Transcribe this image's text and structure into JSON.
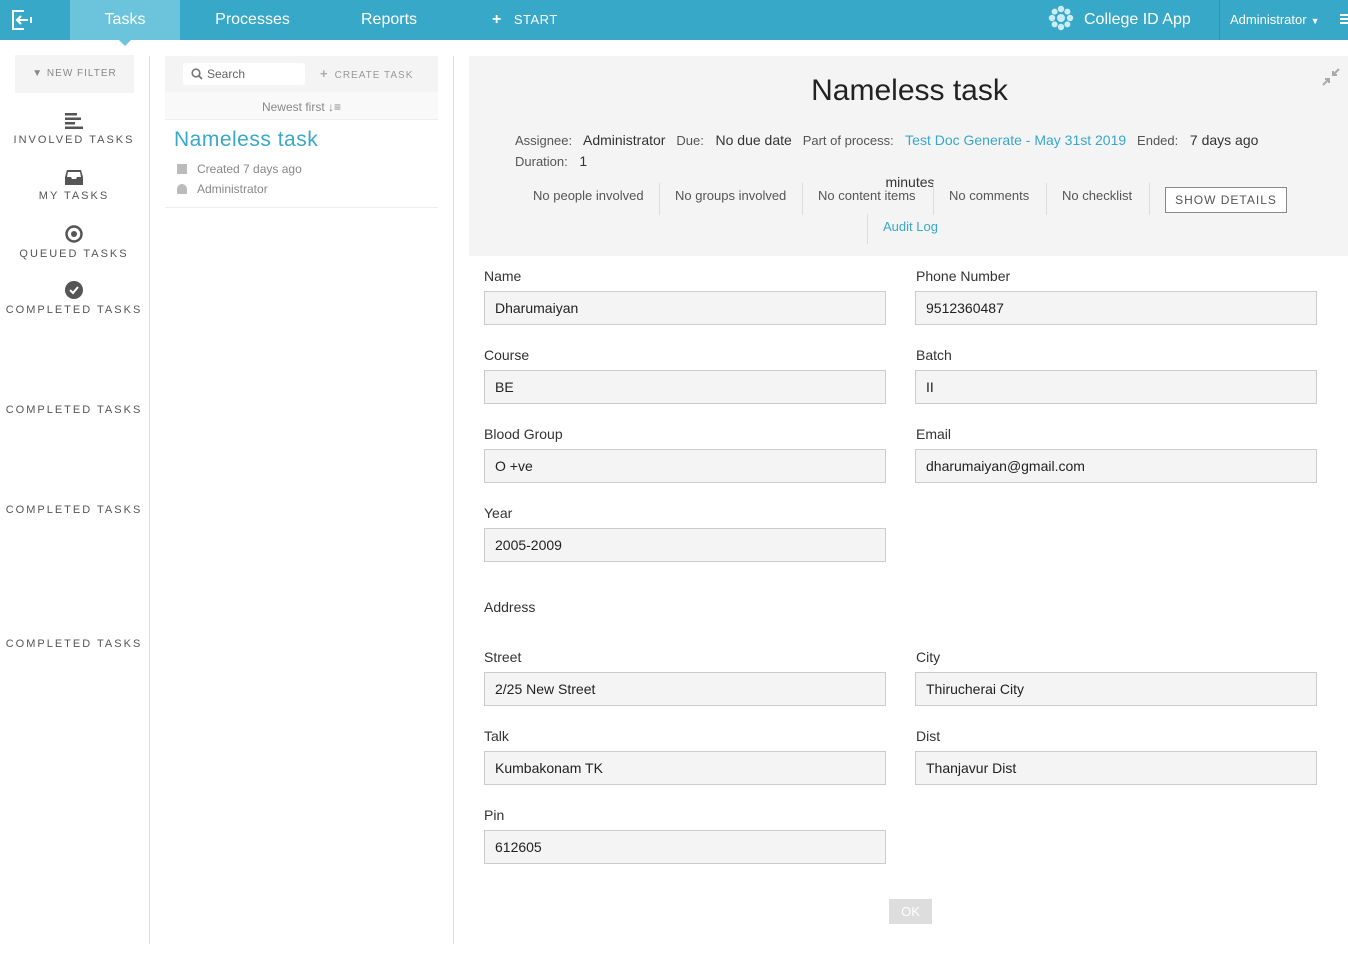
{
  "nav": {
    "tabs": [
      {
        "label": "Tasks",
        "active": true
      },
      {
        "label": "Processes",
        "active": false
      },
      {
        "label": "Reports",
        "active": false
      }
    ],
    "start_label": "START",
    "app_title": "College ID App",
    "user_label": "Administrator",
    "accent_color": "#38a8c9"
  },
  "sidebar": {
    "new_filter_label": "NEW FILTER",
    "items": [
      {
        "label": "INVOLVED TASKS",
        "icon": "involved-tasks-icon"
      },
      {
        "label": "MY TASKS",
        "icon": "inbox-icon"
      },
      {
        "label": "QUEUED TASKS",
        "icon": "queued-icon"
      },
      {
        "label": "COMPLETED TASKS",
        "icon": "check-circle-icon"
      },
      {
        "label": "COMPLETED TASKS"
      },
      {
        "label": "COMPLETED TASKS"
      },
      {
        "label": "COMPLETED TASKS"
      }
    ]
  },
  "task_list": {
    "search_placeholder": "Search",
    "create_task_label": "CREATE TASK",
    "sort_label": "Newest first",
    "tasks": [
      {
        "title": "Nameless task",
        "created": "Created 7 days ago",
        "assignee": "Administrator"
      }
    ]
  },
  "detail": {
    "title": "Nameless task",
    "assignee_label": "Assignee:",
    "assignee": "Administrator",
    "due_label": "Due:",
    "due": "No due date",
    "process_label": "Part of process:",
    "process": "Test Doc Generate - May 31st 2019",
    "ended_label": "Ended:",
    "ended": "7 days ago",
    "duration_label": "Duration:",
    "duration_value": "1",
    "duration_unit": "minutes",
    "people": "No people involved",
    "groups": "No groups involved",
    "content": "No content items",
    "comments": "No comments",
    "checklist": "No checklist",
    "show_details_label": "SHOW DETAILS",
    "audit_log_label": "Audit Log"
  },
  "form": {
    "name_label": "Name",
    "name_value": "Dharumaiyan",
    "phone_label": "Phone Number",
    "phone_value": "9512360487",
    "course_label": "Course",
    "course_value": "BE",
    "batch_label": "Batch",
    "batch_value": "II",
    "blood_label": "Blood Group",
    "blood_value": "O +ve",
    "email_label": "Email",
    "email_value": "dharumaiyan@gmail.com",
    "year_label": "Year",
    "year_value": "2005-2009",
    "address_heading": "Address",
    "street_label": "Street",
    "street_value": "2/25 New Street",
    "city_label": "City",
    "city_value": "Thirucherai City",
    "talk_label": "Talk",
    "talk_value": "Kumbakonam TK",
    "dist_label": "Dist",
    "dist_value": "Thanjavur Dist",
    "pin_label": "Pin",
    "pin_value": "612605",
    "ok_label": "OK"
  }
}
